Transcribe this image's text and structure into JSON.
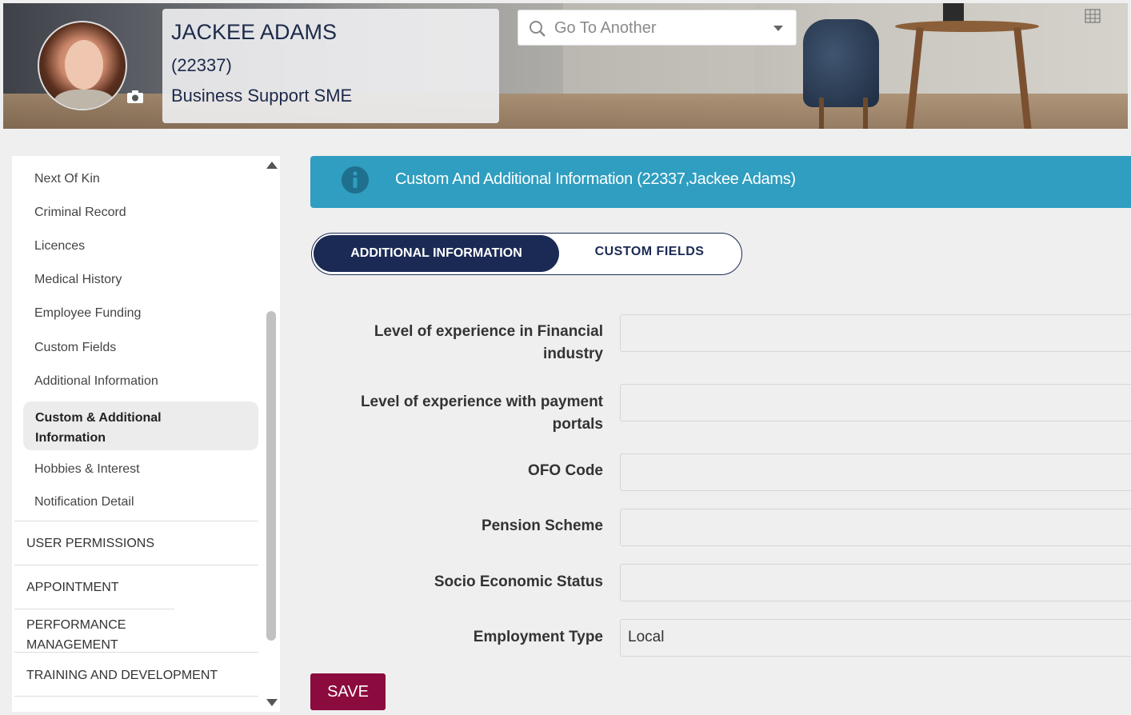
{
  "header": {
    "employee_name": "JACKEE ADAMS",
    "employee_id": "(22337)",
    "role": "Business Support SME",
    "goto_placeholder": "Go To Another"
  },
  "sidebar": {
    "items": [
      {
        "label": "Next Of Kin"
      },
      {
        "label": "Criminal Record"
      },
      {
        "label": "Licences"
      },
      {
        "label": "Medical History"
      },
      {
        "label": "Employee Funding"
      },
      {
        "label": "Custom Fields"
      },
      {
        "label": "Additional Information"
      },
      {
        "label": "Custom & Additional Information",
        "active": true
      },
      {
        "label": "Hobbies & Interest"
      },
      {
        "label": "Notification Detail"
      }
    ],
    "sections": [
      {
        "label": "USER PERMISSIONS"
      },
      {
        "label": "APPOINTMENT"
      },
      {
        "label": "PERFORMANCE MANAGEMENT"
      },
      {
        "label": "TRAINING AND DEVELOPMENT"
      }
    ]
  },
  "main": {
    "banner_title": "Custom And Additional Information (22337,Jackee Adams)",
    "tabs": [
      {
        "label": "ADDITIONAL INFORMATION",
        "active": true
      },
      {
        "label": "CUSTOM FIELDS",
        "active": false
      }
    ],
    "fields": [
      {
        "label": "Level of experience in Financial industry",
        "value": ""
      },
      {
        "label": "Level of experience with payment portals",
        "value": ""
      },
      {
        "label": "OFO Code",
        "value": ""
      },
      {
        "label": "Pension Scheme",
        "value": ""
      },
      {
        "label": "Socio Economic Status",
        "value": ""
      },
      {
        "label": "Employment Type",
        "value": "Local"
      }
    ],
    "save_label": "SAVE"
  },
  "colors": {
    "banner": "#2f9ec0",
    "tab_active": "#1b2a55",
    "save_button": "#8c0b3e"
  },
  "icons": [
    "camera-icon",
    "search-icon",
    "chevron-down-icon",
    "grid-icon",
    "info-icon"
  ]
}
